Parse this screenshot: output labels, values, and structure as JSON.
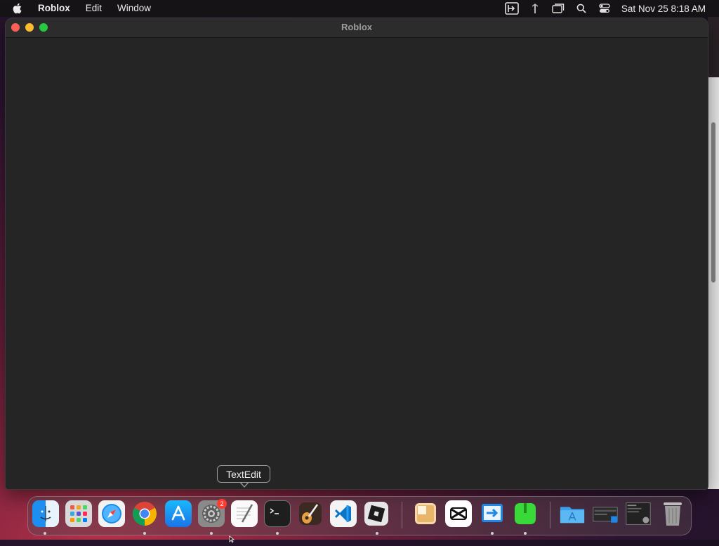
{
  "menubar": {
    "app_name": "Roblox",
    "items": [
      "Edit",
      "Window"
    ],
    "clock": "Sat Nov 25  8:18 AM"
  },
  "window": {
    "title": "Roblox"
  },
  "tooltip": {
    "text": "TextEdit"
  },
  "dock": {
    "badge_count": "2",
    "apps": [
      "Finder",
      "Launchpad",
      "Safari",
      "Google Chrome",
      "App Store",
      "System Settings",
      "TextEdit",
      "Terminal",
      "GarageBand",
      "Visual Studio Code",
      "Roblox",
      "Archive Utility",
      "CapCut",
      "Migration Assistant",
      "Unknown Green App",
      "Applications Folder",
      "Screenshot",
      "Screenshot 2",
      "Trash"
    ]
  }
}
